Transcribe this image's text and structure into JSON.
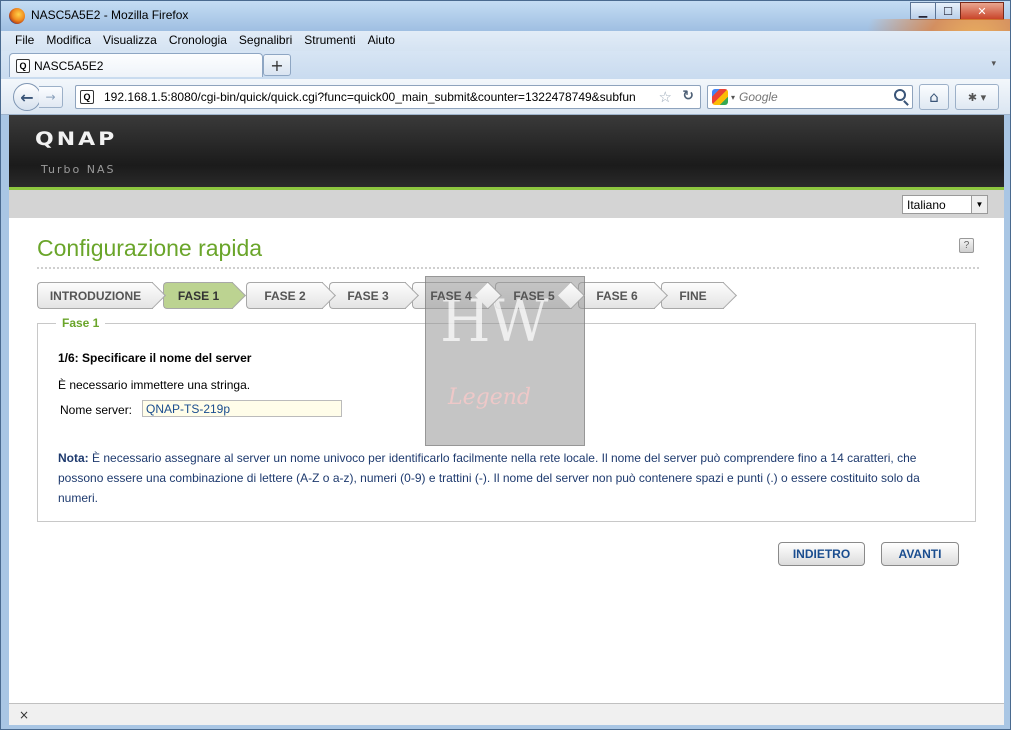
{
  "window": {
    "title": "NASC5A5E2 - Mozilla Firefox",
    "minimize": "▁",
    "maximize": "☐",
    "close": "✕"
  },
  "menu": [
    "File",
    "Modifica",
    "Visualizza",
    "Cronologia",
    "Segnalibri",
    "Strumenti",
    "Aiuto"
  ],
  "tab": {
    "label": "NASC5A5E2",
    "favicon": "Q",
    "new_tab": "+"
  },
  "nav": {
    "url": "192.168.1.5:8080/cgi-bin/quick/quick.cgi?func=quick00_main_submit&counter=1322478749&subfun",
    "search_placeholder": "Google"
  },
  "qnap": {
    "logo": "QNAP",
    "subtitle": "Turbo NAS",
    "language": "Italiano"
  },
  "page": {
    "title": "Configurazione rapida",
    "help": "?",
    "steps": [
      "INTRODUZIONE",
      "FASE 1",
      "FASE 2",
      "FASE 3",
      "FASE 4",
      "FASE 5",
      "FASE 6",
      "FINE"
    ],
    "active_step": "FASE 1",
    "panel_legend": "Fase 1",
    "step_heading": "1/6: Specificare il nome del server",
    "requirement": "È necessario immettere una stringa.",
    "server_label": "Nome server:",
    "server_value": "QNAP-TS-219p",
    "note_label": "Nota:",
    "note_text": " È necessario assegnare al server un nome univoco per identificarlo facilmente nella rete locale. Il nome del server può comprendere fino a 14 caratteri, che possono essere una combinazione di lettere (A-Z o a-z), numeri (0-9) e trattini (-). Il nome del server non può contenere spazi e punti (.) o essere costituito solo da numeri.",
    "back_button": "INDIETRO",
    "next_button": "AVANTI"
  },
  "watermark": {
    "top": "HW",
    "bottom": "Legend"
  },
  "status": {
    "close_icon": "×"
  }
}
